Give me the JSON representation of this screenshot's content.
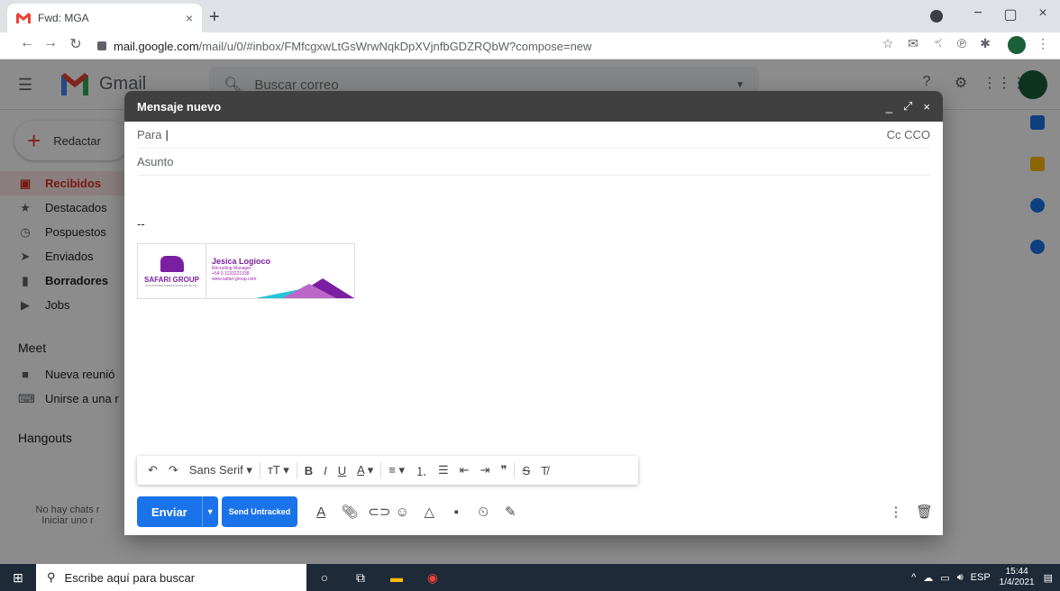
{
  "browser": {
    "tab_title": "Fwd: MGA",
    "tab_close": "×",
    "new_tab": "+",
    "url_host": "mail.google.com",
    "url_path": "/mail/u/0/#inbox/FMfcgxwLtGsWrwNqkDpXVjnfbGDZRQbW?compose=new",
    "window_controls": [
      "−",
      "▢",
      "×"
    ]
  },
  "gmail": {
    "product_name": "Gmail",
    "search_placeholder": "Buscar correo",
    "compose_label": "Redactar",
    "sidebar": [
      {
        "label": "Recibidos",
        "icon": "inbox-icon",
        "active": true
      },
      {
        "label": "Destacados",
        "icon": "star-icon"
      },
      {
        "label": "Pospuestos",
        "icon": "clock-icon"
      },
      {
        "label": "Enviados",
        "icon": "send-icon"
      },
      {
        "label": "Borradores",
        "icon": "draft-icon",
        "bold": true
      },
      {
        "label": "Jobs",
        "icon": "label-icon"
      }
    ],
    "meet_title": "Meet",
    "meet_items": [
      {
        "label": "Nueva reunió",
        "icon": "video-icon"
      },
      {
        "label": "Unirse a una r",
        "icon": "keyboard-icon"
      }
    ],
    "hangouts_title": "Hangouts",
    "no_chats_text": "No hay chats r",
    "start_link": "Iniciar uno r"
  },
  "compose": {
    "title": "Mensaje nuevo",
    "to_label": "Para",
    "cc_bcc": "Cc CCO",
    "subject_placeholder": "Asunto",
    "signature_dash": "--",
    "signature": {
      "company": "SAFARI GROUP",
      "tagline": "SOLUCIONES GERENCIALES EN RR.HH.",
      "name": "Jesica Logioco",
      "role": "Recruiting Manager",
      "phone": "+54 9 1133221338",
      "website": "www.safari-group.com"
    },
    "format": {
      "font": "Sans Serif"
    },
    "send_label": "Enviar",
    "untracked_label": "Send Untracked"
  },
  "taskbar": {
    "search_placeholder": "Escribe aquí para buscar",
    "language": "ESP",
    "time": "15:44",
    "date": "1/4/2021"
  },
  "colors": {
    "accent_blue": "#1a73e8",
    "compose_header": "#404040",
    "brand_purple": "#7b1fa2",
    "inbox_red": "#d93025"
  }
}
